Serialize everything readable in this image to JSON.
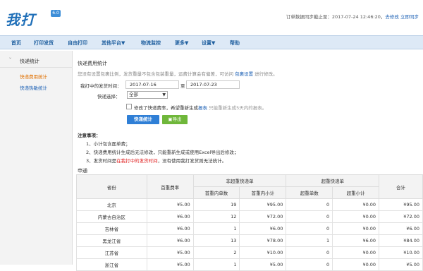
{
  "header": {
    "logo_text": "我打",
    "logo_badge": "6.0",
    "sync_text": "订单数据同步截止至：2017-07-24 12:46:20，",
    "sync_link": "去修改",
    "sync_link2": "立即同步"
  },
  "nav": [
    "首页",
    "打印发货",
    "自由打印",
    "其他平台▼",
    "物流监控",
    "更多▼",
    "设置▼",
    "帮助"
  ],
  "sidebar": {
    "arrow": "⌄",
    "heading": "快递统计",
    "items": [
      "快递费用统计",
      "快递热敏统计"
    ]
  },
  "main": {
    "title": "快递费用统计",
    "notice_pre": "您没有设置包裹比例，发货重量不包含包装重量，运费计算会有偏差，可访问",
    "notice_link": "包裹设置",
    "notice_post": "进行修改。",
    "time_label": "我打中的发货时间：",
    "date_from": "2017-07-16",
    "to_label": "至",
    "date_to": "2017-07-23",
    "express_label": "快递选择：",
    "express_value": "全部",
    "checkbox_pre": "修改了快递费率，希望重新生成",
    "checkbox_link": "报表",
    "checkbox_note": "只能重新生成5天内的报表。",
    "stat_button": "快递统计",
    "export_button": "导出",
    "notes_head": "注意事项：",
    "notes": [
      "1、小计包含面单费；",
      "2、快递费用统计生成后无法修改，只能重新生成或使用Excel导出后修改；",
      "3、发货时间是"
    ],
    "note3_red": "在我打中的发货时间",
    "note3_post": "，没有使用我打发货则无法统计。",
    "section": "申通"
  },
  "table": {
    "headers": {
      "province": "省份",
      "first_weight": "首重费率",
      "normal_group": "非超重快递单",
      "normal_count": "首重内单数",
      "normal_subtotal": "首重内小计",
      "over_group": "超重快递单",
      "over_count": "超重单数",
      "over_subtotal": "超重小计",
      "total": "合计"
    },
    "rows": [
      {
        "province": "北京",
        "rate": "¥5.00",
        "count": "19",
        "subtotal": "¥95.00",
        "over_count": "0",
        "over_subtotal": "¥0.00",
        "total": "¥95.00"
      },
      {
        "province": "内蒙古自治区",
        "rate": "¥6.00",
        "count": "12",
        "subtotal": "¥72.00",
        "over_count": "0",
        "over_subtotal": "¥0.00",
        "total": "¥72.00"
      },
      {
        "province": "吉林省",
        "rate": "¥6.00",
        "count": "1",
        "subtotal": "¥6.00",
        "over_count": "0",
        "over_subtotal": "¥0.00",
        "total": "¥6.00"
      },
      {
        "province": "黑龙江省",
        "rate": "¥6.00",
        "count": "13",
        "subtotal": "¥78.00",
        "over_count": "1",
        "over_subtotal": "¥6.00",
        "total": "¥84.00"
      },
      {
        "province": "江苏省",
        "rate": "¥5.00",
        "count": "2",
        "subtotal": "¥10.00",
        "over_count": "0",
        "over_subtotal": "¥0.00",
        "total": "¥10.00"
      },
      {
        "province": "浙江省",
        "rate": "¥5.00",
        "count": "1",
        "subtotal": "¥5.00",
        "over_count": "0",
        "over_subtotal": "¥0.00",
        "total": "¥5.00"
      }
    ]
  }
}
